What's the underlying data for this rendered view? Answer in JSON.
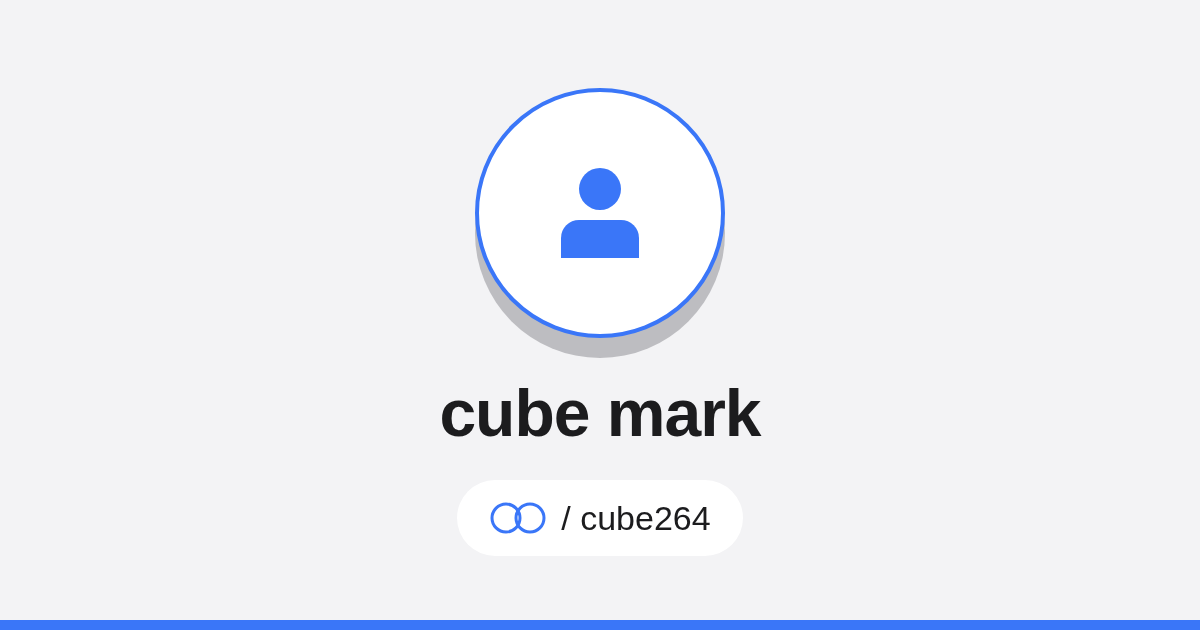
{
  "profile": {
    "name": "cube mark"
  },
  "handle": {
    "text": "/ cube264"
  }
}
